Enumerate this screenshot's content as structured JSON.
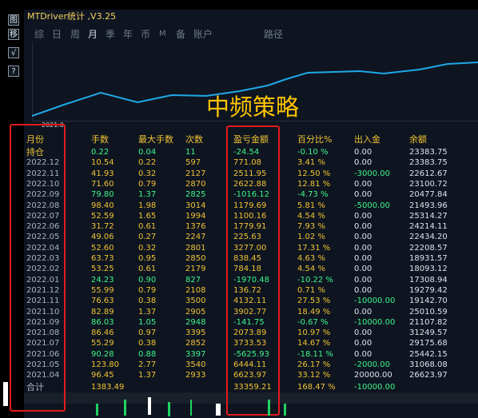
{
  "window": {
    "title": "MTDriver统计 ,V3.25"
  },
  "sidebar_icons": [
    "toolbar-icon-1",
    "toolbar-icon-2",
    "toolbar-icon-3",
    "help-icon"
  ],
  "sidebar_glyphs": [
    "图",
    "移",
    "√",
    "?"
  ],
  "tabs": [
    "综",
    "日",
    "周",
    "月",
    "季",
    "年",
    "币",
    "M",
    "备",
    "账户",
    "路径"
  ],
  "active_tab": "月",
  "chart": {
    "overlay_title": "中频策略",
    "x_start_label": "2021.0"
  },
  "table": {
    "headers": [
      "月份",
      "手数",
      "最大手数",
      "次数",
      "盈亏金额",
      "百分比%",
      "出入金",
      "余额"
    ],
    "rows": [
      [
        "持仓",
        "0.22",
        "0.04",
        "11",
        "-24.54",
        "-0.10 %",
        "0.00",
        "23383.75"
      ],
      [
        "2022.12",
        "10.54",
        "0.22",
        "597",
        "771.08",
        "3.41 %",
        "0.00",
        "23383.75"
      ],
      [
        "2022.11",
        "41.93",
        "0.32",
        "2127",
        "2511.95",
        "12.50 %",
        "-3000.00",
        "22612.67"
      ],
      [
        "2022.10",
        "71.60",
        "0.79",
        "2870",
        "2622.88",
        "12.81 %",
        "0.00",
        "23100.72"
      ],
      [
        "2022.09",
        "79.80",
        "1.37",
        "2825",
        "-1016.12",
        "-4.73 %",
        "0.00",
        "20477.84"
      ],
      [
        "2022.08",
        "98.40",
        "1.98",
        "3014",
        "1179.69",
        "5.81 %",
        "-5000.00",
        "21493.96"
      ],
      [
        "2022.07",
        "52.59",
        "1.65",
        "1994",
        "1100.16",
        "4.54 %",
        "0.00",
        "25314.27"
      ],
      [
        "2022.06",
        "31.72",
        "0.61",
        "1376",
        "1779.91",
        "7.93 %",
        "0.00",
        "24214.11"
      ],
      [
        "2022.05",
        "49.06",
        "0.27",
        "2247",
        "225.63",
        "1.02 %",
        "0.00",
        "22434.20"
      ],
      [
        "2022.04",
        "52.60",
        "0.32",
        "2801",
        "3277.00",
        "17.31 %",
        "0.00",
        "22208.57"
      ],
      [
        "2022.03",
        "63.73",
        "0.95",
        "2850",
        "838.45",
        "4.63 %",
        "0.00",
        "18931.57"
      ],
      [
        "2022.02",
        "53.25",
        "0.61",
        "2179",
        "784.18",
        "4.54 %",
        "0.00",
        "18093.12"
      ],
      [
        "2022.01",
        "24.23",
        "0.90",
        "827",
        "-1970.48",
        "-10.22 %",
        "0.00",
        "17308.94"
      ],
      [
        "2021.12",
        "55.99",
        "0.79",
        "2108",
        "136.72",
        "0.71 %",
        "0.00",
        "19279.42"
      ],
      [
        "2021.11",
        "76.63",
        "0.38",
        "3500",
        "4132.11",
        "27.53 %",
        "-10000.00",
        "19142.70"
      ],
      [
        "2021.10",
        "82.89",
        "1.37",
        "2905",
        "3902.77",
        "18.49 %",
        "0.00",
        "25010.59"
      ],
      [
        "2021.09",
        "86.03",
        "1.05",
        "2948",
        "-141.75",
        "-0.67 %",
        "-10000.00",
        "21107.82"
      ],
      [
        "2021.08",
        "86.46",
        "0.97",
        "3395",
        "2073.89",
        "10.97 %",
        "0.00",
        "31249.57"
      ],
      [
        "2021.07",
        "55.29",
        "0.38",
        "2852",
        "3733.53",
        "14.67 %",
        "0.00",
        "29175.68"
      ],
      [
        "2021.06",
        "90.28",
        "0.88",
        "3397",
        "-5625.93",
        "-18.11 %",
        "0.00",
        "25442.15"
      ],
      [
        "2021.05",
        "123.80",
        "2.77",
        "3540",
        "6444.11",
        "26.17 %",
        "-2000.00",
        "31068.08"
      ],
      [
        "2021.04",
        "96.45",
        "1.37",
        "2933",
        "6623.97",
        "33.12 %",
        "20000.00",
        "26623.97"
      ]
    ],
    "total": [
      "合计",
      "1383.49",
      "",
      "",
      "33359.21",
      "168.47 %",
      "-10000.00",
      ""
    ]
  }
}
